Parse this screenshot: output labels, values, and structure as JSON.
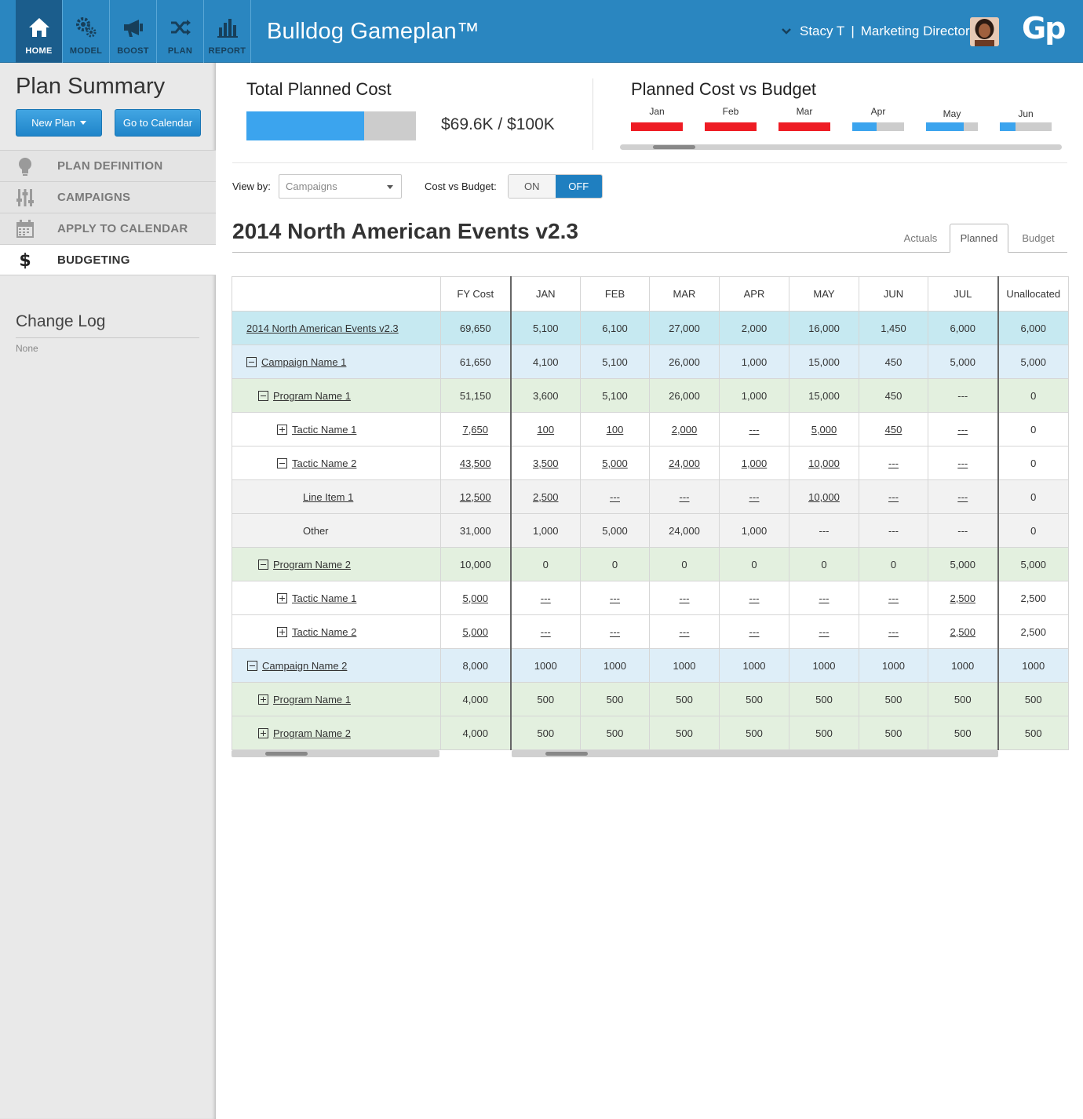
{
  "app": {
    "brand": "Bulldog Gameplan™",
    "logo": "Gp",
    "user_name": "Stacy T",
    "user_separator": "|",
    "user_role": "Marketing Director"
  },
  "nav": [
    {
      "label": "HOME",
      "icon": "home-icon",
      "active": true
    },
    {
      "label": "MODEL",
      "icon": "gears-icon",
      "active": false
    },
    {
      "label": "BOOST",
      "icon": "megaphone-icon",
      "active": false
    },
    {
      "label": "PLAN",
      "icon": "shuffle-icon",
      "active": false
    },
    {
      "label": "REPORT",
      "icon": "bar-chart-icon",
      "active": false
    }
  ],
  "sidebar": {
    "title": "Plan Summary",
    "new_plan": "New Plan",
    "go_calendar": "Go to Calendar",
    "items": [
      {
        "label": "PLAN DEFINITION",
        "icon": "lightbulb-icon"
      },
      {
        "label": "CAMPAIGNS",
        "icon": "sliders-icon"
      },
      {
        "label": "APPLY TO CALENDAR",
        "icon": "calendar-icon"
      },
      {
        "label": "BUDGETING",
        "icon": "dollar-icon"
      }
    ],
    "active_item": "BUDGETING",
    "changelog_title": "Change Log",
    "changelog_value": "None"
  },
  "summary": {
    "total_title": "Total Planned Cost",
    "total_value": "$69.6K / $100K",
    "total_fraction": 0.696,
    "pcb_title": "Planned Cost vs Budget",
    "months": [
      {
        "label": "Jan",
        "fraction": 1.0,
        "over": true
      },
      {
        "label": "Feb",
        "fraction": 1.0,
        "over": true
      },
      {
        "label": "Mar",
        "fraction": 1.0,
        "over": true
      },
      {
        "label": "Apr",
        "fraction": 0.47,
        "over": false
      },
      {
        "label": "May",
        "fraction": 0.72,
        "over": false
      },
      {
        "label": "Jun",
        "fraction": 0.3,
        "over": false
      }
    ],
    "colors": {
      "over": "#ee1c24",
      "under": "#3ba4ee",
      "track": "#cccccc"
    }
  },
  "controls": {
    "view_by_label": "View by:",
    "view_by_value": "Campaigns",
    "cost_vs_budget_label": "Cost vs Budget:",
    "toggle_on": "ON",
    "toggle_off": "OFF",
    "toggle_state": "OFF"
  },
  "plan": {
    "title": "2014 North American Events v2.3",
    "tabs": [
      "Actuals",
      "Planned",
      "Budget"
    ],
    "active_tab": "Planned"
  },
  "table": {
    "headers": [
      "",
      "FY Cost",
      "JAN",
      "FEB",
      "MAR",
      "APR",
      "MAY",
      "JUN",
      "JUL",
      "Unallocated"
    ],
    "rows": [
      {
        "name": "2014 North American Events v2.3",
        "cells": [
          "69,650",
          "5,100",
          "6,100",
          "27,000",
          "2,000",
          "16,000",
          "1,450",
          "6,000",
          "6,000"
        ]
      },
      {
        "name": "Campaign Name 1",
        "cells": [
          "61,650",
          "4,100",
          "5,100",
          "26,000",
          "1,000",
          "15,000",
          "450",
          "5,000",
          "5,000"
        ]
      },
      {
        "name": "Program Name 1",
        "cells": [
          "51,150",
          "3,600",
          "5,100",
          "26,000",
          "1,000",
          "15,000",
          "450",
          "---",
          "0"
        ]
      },
      {
        "name": "Tactic Name 1",
        "cells": [
          "7,650",
          "100",
          "100",
          "2,000",
          "---",
          "5,000",
          "450",
          "---",
          "0"
        ]
      },
      {
        "name": "Tactic Name 2",
        "cells": [
          "43,500",
          "3,500",
          "5,000",
          "24,000",
          "1,000",
          "10,000",
          "---",
          "---",
          "0"
        ]
      },
      {
        "name": "Line Item 1",
        "cells": [
          "12,500",
          "2,500",
          "---",
          "---",
          "---",
          "10,000",
          "---",
          "---",
          "0"
        ]
      },
      {
        "name": "Other",
        "cells": [
          "31,000",
          "1,000",
          "5,000",
          "24,000",
          "1,000",
          "---",
          "---",
          "---",
          "0"
        ]
      },
      {
        "name": "Program Name 2",
        "cells": [
          "10,000",
          "0",
          "0",
          "0",
          "0",
          "0",
          "0",
          "5,000",
          "5,000"
        ]
      },
      {
        "name": "Tactic Name 1",
        "cells": [
          "5,000",
          "---",
          "---",
          "---",
          "---",
          "---",
          "---",
          "2,500",
          "2,500"
        ]
      },
      {
        "name": "Tactic Name 2",
        "cells": [
          "5,000",
          "---",
          "---",
          "---",
          "---",
          "---",
          "---",
          "2,500",
          "2,500"
        ]
      },
      {
        "name": "Campaign Name 2",
        "cells": [
          "8,000",
          "1000",
          "1000",
          "1000",
          "1000",
          "1000",
          "1000",
          "1000",
          "1000"
        ]
      },
      {
        "name": "Program Name 1",
        "cells": [
          "4,000",
          "500",
          "500",
          "500",
          "500",
          "500",
          "500",
          "500",
          "500"
        ]
      },
      {
        "name": "Program Name 2",
        "cells": [
          "4,000",
          "500",
          "500",
          "500",
          "500",
          "500",
          "500",
          "500",
          "500"
        ]
      }
    ]
  }
}
